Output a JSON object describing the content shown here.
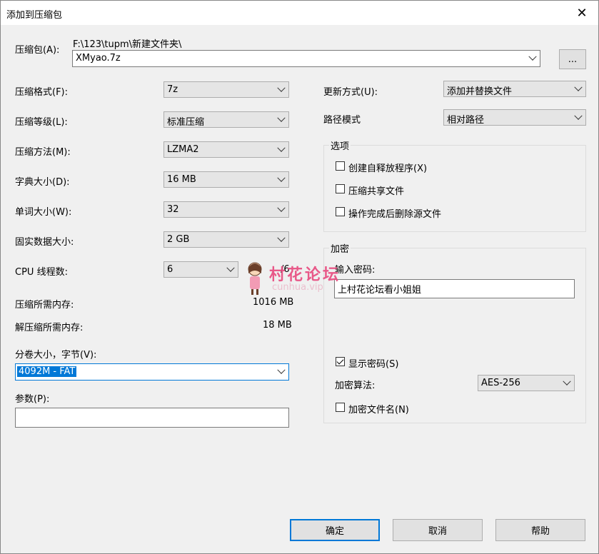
{
  "title": "添加到压缩包",
  "archive": {
    "label": "压缩包(A):",
    "path": "F:\\123\\tupm\\新建文件夹\\",
    "value": "XMyao.7z",
    "browse_label": "..."
  },
  "left": {
    "format_label": "压缩格式(F):",
    "format_value": "7z",
    "level_label": "压缩等级(L):",
    "level_value": "标准压缩",
    "method_label": "压缩方法(M):",
    "method_value": "LZMA2",
    "dict_label": "字典大小(D):",
    "dict_value": "16 MB",
    "word_label": "单词大小(W):",
    "word_value": "32",
    "solid_label": "固实数据大小:",
    "solid_value": "2 GB",
    "cpu_label": "CPU 线程数:",
    "cpu_value": "6",
    "cpu_total": "/6",
    "mem_comp_label": "压缩所需内存:",
    "mem_comp_value": "1016 MB",
    "mem_decomp_label": "解压缩所需内存:",
    "mem_decomp_value": "18 MB",
    "volume_label": "分卷大小，字节(V):",
    "volume_value": "4092M - FAT",
    "params_label": "参数(P):",
    "params_value": ""
  },
  "right": {
    "update_label": "更新方式(U):",
    "update_value": "添加并替换文件",
    "pathmode_label": "路径模式",
    "pathmode_value": "相对路径",
    "options_title": "选项",
    "opt_sfx": "创建自释放程序(X)",
    "opt_shared": "压缩共享文件",
    "opt_delete": "操作完成后删除源文件",
    "encrypt_title": "加密",
    "pwd_label": "输入密码:",
    "pwd_value": "上村花论坛看小姐姐",
    "show_pwd": "显示密码(S)",
    "enc_method_label": "加密算法:",
    "enc_method_value": "AES-256",
    "enc_names": "加密文件名(N)"
  },
  "buttons": {
    "ok": "确定",
    "cancel": "取消",
    "help": "帮助"
  },
  "watermark": {
    "text": "村花论坛",
    "sub": "cunhua.vip"
  }
}
